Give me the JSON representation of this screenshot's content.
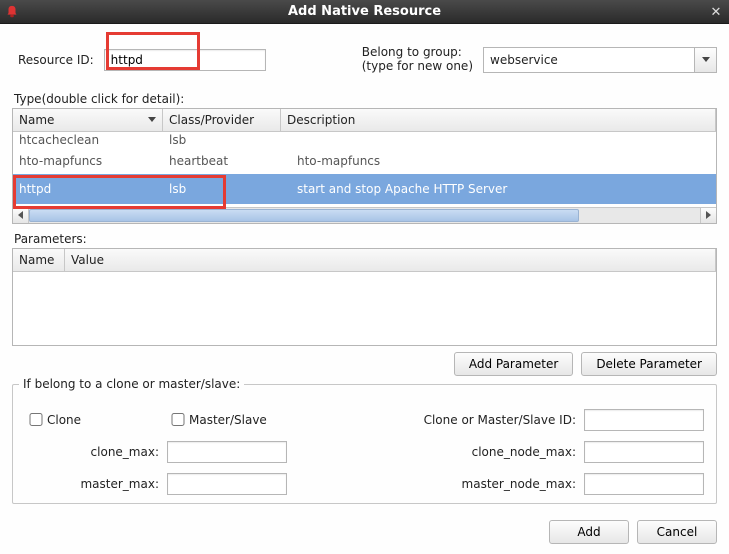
{
  "titlebar": {
    "title": "Add Native Resource"
  },
  "top": {
    "resource_id_label": "Resource ID:",
    "resource_id_value": "httpd",
    "belong_to_group_label": "Belong to group:",
    "belong_to_group_sub": "(type for new one)",
    "group_value": "webservice"
  },
  "type": {
    "heading": "Type(double click for detail):",
    "columns": {
      "name": "Name",
      "class": "Class/Provider",
      "description": "Description"
    },
    "rows": [
      {
        "name": "htcacheclean",
        "class": "lsb",
        "desc": ""
      },
      {
        "name": "hto-mapfuncs",
        "class": "heartbeat",
        "desc": "hto-mapfuncs"
      },
      {
        "name": "httpd",
        "class": "lsb",
        "desc": "start and stop Apache HTTP Server",
        "selected": true
      }
    ]
  },
  "params": {
    "heading": "Parameters:",
    "columns": {
      "name": "Name",
      "value": "Value"
    },
    "buttons": {
      "add": "Add Parameter",
      "delete": "Delete Parameter"
    }
  },
  "clone": {
    "legend": "If belong to a clone or master/slave:",
    "clone_label": "Clone",
    "master_label": "Master/Slave",
    "clone_or_master_id_label": "Clone or Master/Slave ID:",
    "clone_max_label": "clone_max:",
    "clone_node_max_label": "clone_node_max:",
    "master_max_label": "master_max:",
    "master_node_max_label": "master_node_max:"
  },
  "footer": {
    "add": "Add",
    "cancel": "Cancel"
  }
}
